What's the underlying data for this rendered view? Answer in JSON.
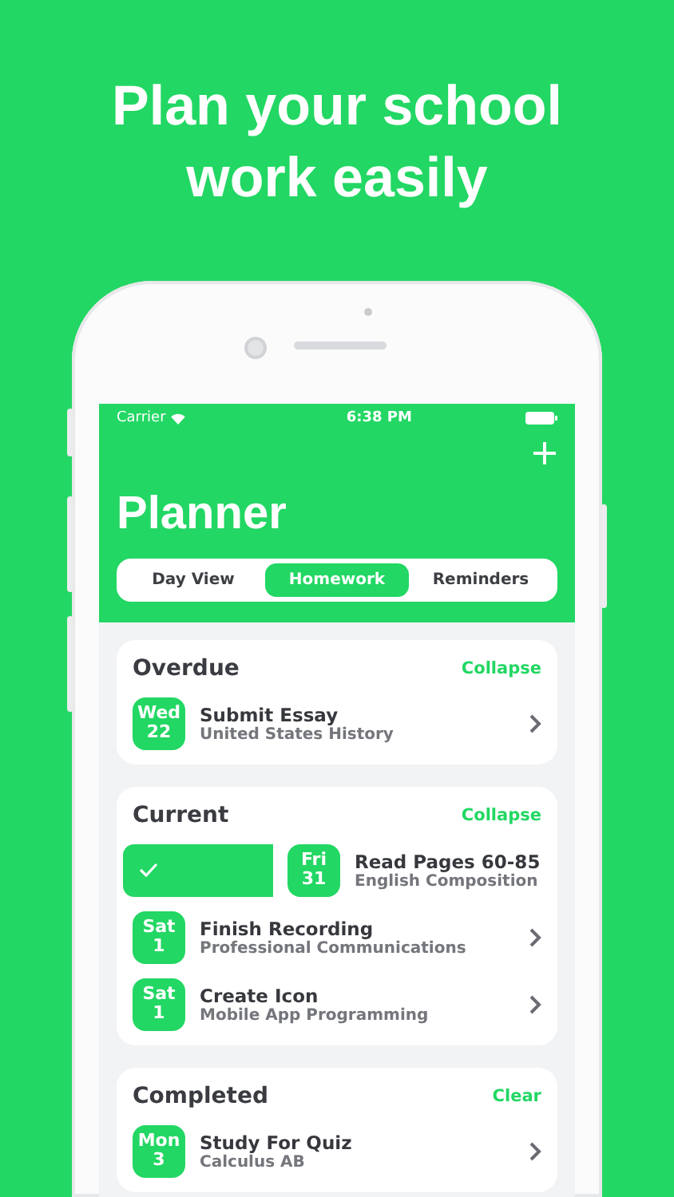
{
  "headline": "Plan your school work easily",
  "status_bar": {
    "carrier": "Carrier",
    "time": "6:38 PM"
  },
  "title": "Planner",
  "tabs": [
    {
      "label": "Day View",
      "selected": false
    },
    {
      "label": "Homework",
      "selected": true
    },
    {
      "label": "Reminders",
      "selected": false
    }
  ],
  "sections": [
    {
      "title": "Overdue",
      "action": "Collapse",
      "tasks": [
        {
          "kind": "normal",
          "day": "Wed",
          "date": "22",
          "title": "Submit Essay",
          "subject": "United States History"
        }
      ]
    },
    {
      "title": "Current",
      "action": "Collapse",
      "tasks": [
        {
          "kind": "swiped",
          "day": "Fri",
          "date": "31",
          "title": "Read Pages 60-85",
          "subject": "English Composition"
        },
        {
          "kind": "normal",
          "day": "Sat",
          "date": "1",
          "title": "Finish Recording",
          "subject": "Professional Communications"
        },
        {
          "kind": "normal",
          "day": "Sat",
          "date": "1",
          "title": "Create Icon",
          "subject": "Mobile App Programming"
        }
      ]
    },
    {
      "title": "Completed",
      "action": "Clear",
      "tasks": [
        {
          "kind": "normal",
          "day": "Mon",
          "date": "3",
          "title": "Study For Quiz",
          "subject": "Calculus AB"
        }
      ]
    }
  ]
}
